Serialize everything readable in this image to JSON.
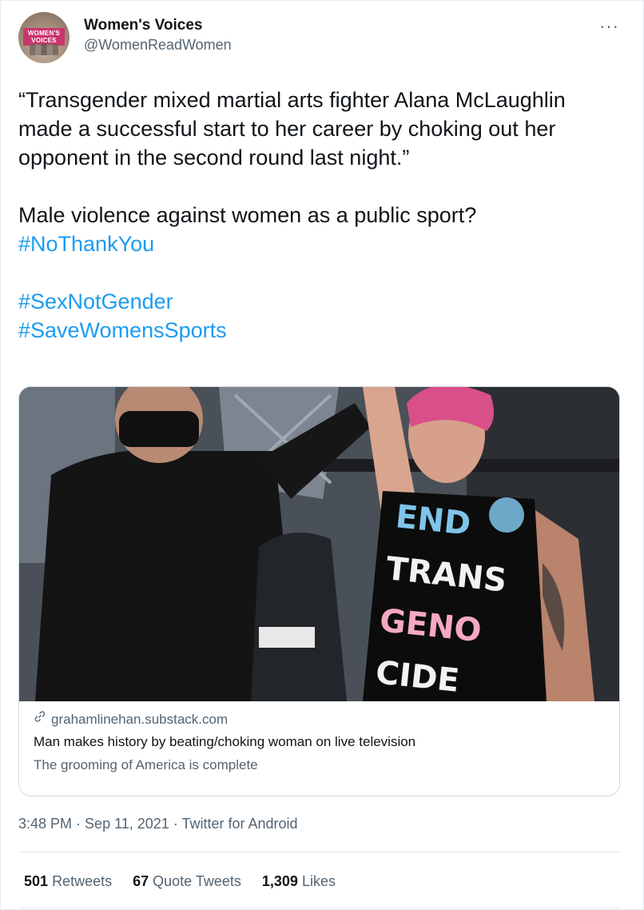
{
  "author": {
    "display_name": "Women's Voices",
    "handle": "@WomenReadWomen",
    "avatar_text": "WOMEN'S VOICES"
  },
  "more_icon": "more-horizontal-icon",
  "tweet": {
    "line1": "“Transgender mixed martial arts fighter Alana McLaughlin made a successful start to her career by choking out her opponent in the second round last night.”",
    "line2": "Male violence against women as a public sport?",
    "hashtag1": "#NoThankYou",
    "hashtag2": "#SexNotGender",
    "hashtag3": "#SaveWomensSports"
  },
  "card": {
    "image_shirt_text": [
      "END",
      "TRANS",
      "GENO",
      "CIDE"
    ],
    "domain": "grahamlinehan.substack.com",
    "title": "Man makes history by beating/choking woman on live television",
    "description": "The grooming of America is complete",
    "link_icon": "link-icon"
  },
  "meta": {
    "time": "3:48 PM",
    "sep1": " · ",
    "date": "Sep 11, 2021",
    "sep2": " · ",
    "source": "Twitter for Android"
  },
  "stats": {
    "retweets_count": "501",
    "retweets_label": "Retweets",
    "quotes_count": "67",
    "quotes_label": "Quote Tweets",
    "likes_count": "1,309",
    "likes_label": "Likes"
  },
  "colors": {
    "link_blue": "#1d9bf0",
    "secondary_text": "#536471",
    "primary_text": "#0f1419",
    "border": "#cfd9de"
  }
}
